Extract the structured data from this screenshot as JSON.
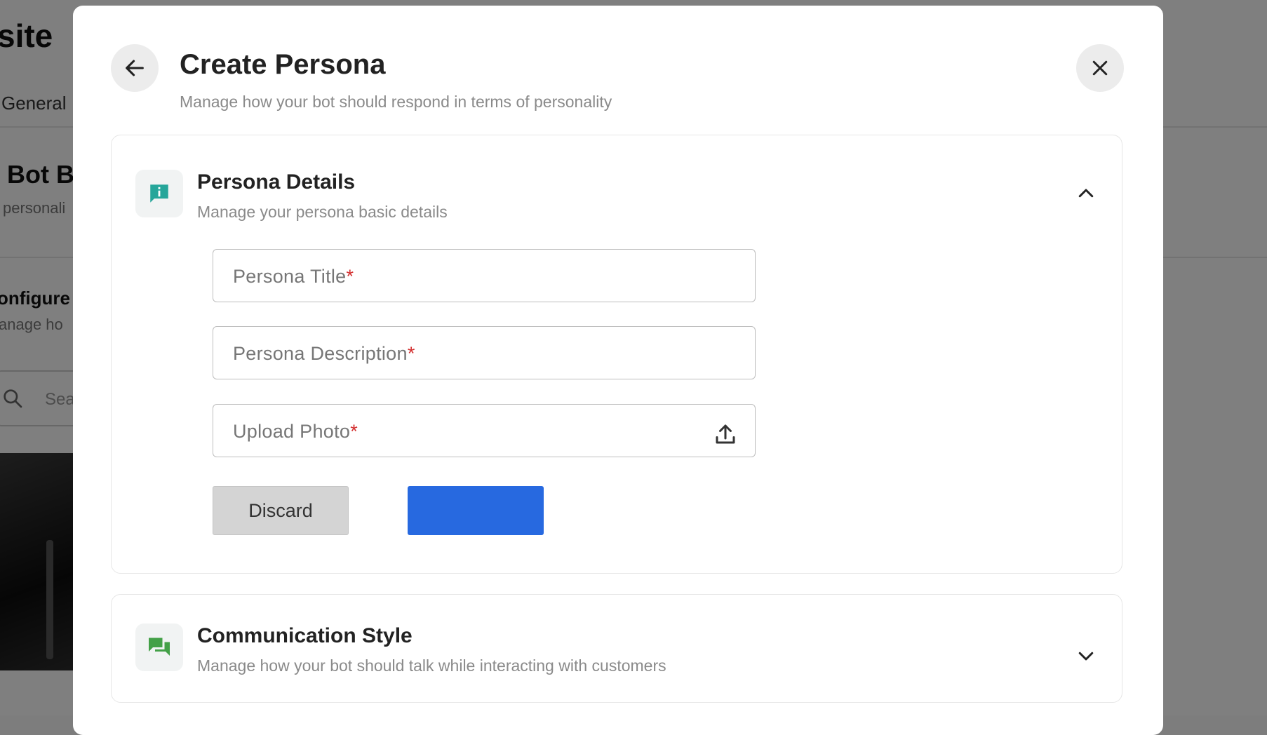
{
  "background": {
    "page_title": "site",
    "tab_label": "General",
    "section_heading": "Bot B",
    "section_sub": "personali",
    "config_heading": "onfigure",
    "config_sub": "anage ho",
    "search_placeholder": "Sea"
  },
  "modal": {
    "title": "Create Persona",
    "subtitle": "Manage how your bot should respond in terms of personality",
    "back_icon": "arrow-left-icon",
    "close_icon": "close-icon"
  },
  "persona_details": {
    "title": "Persona Details",
    "subtitle": "Manage your persona basic details",
    "icon": "info-chat-icon",
    "icon_color": "#26a69a",
    "expanded": true,
    "fields": {
      "title": {
        "label": "Persona Title",
        "required_mark": "*",
        "value": ""
      },
      "description": {
        "label": "Persona Description",
        "required_mark": "*",
        "value": ""
      },
      "photo": {
        "label": "Upload Photo",
        "required_mark": "*",
        "icon": "upload-icon"
      }
    },
    "discard_label": "Discard",
    "save_label": "",
    "save_color": "#2769e0"
  },
  "communication_style": {
    "title": "Communication Style",
    "subtitle": "Manage how your bot should talk while interacting with customers",
    "icon": "chat-bubbles-icon",
    "icon_color": "#43a047",
    "expanded": false
  }
}
